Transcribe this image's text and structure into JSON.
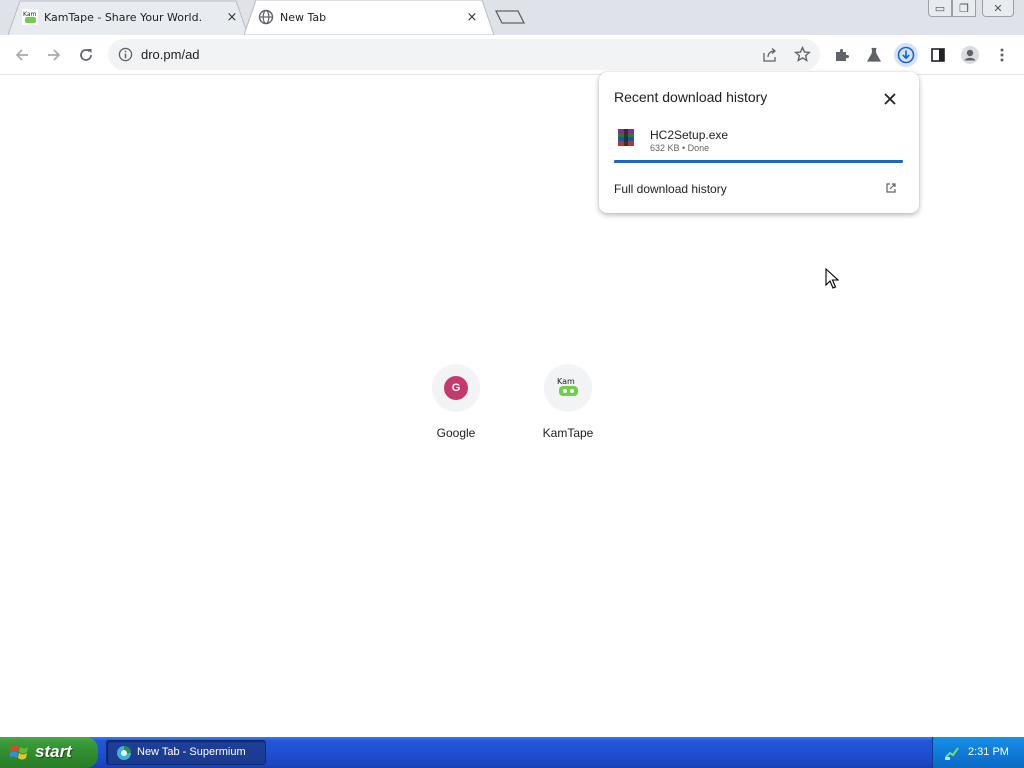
{
  "tabs": [
    {
      "title": "KamTape - Share Your World.",
      "active": false,
      "close": "×"
    },
    {
      "title": "New Tab",
      "active": true,
      "close": "×"
    }
  ],
  "window_controls": {
    "minimize": "▭",
    "restore": "❐",
    "close": "✕"
  },
  "toolbar": {
    "url": "dro.pm/ad",
    "icons": [
      "back-icon",
      "forward-icon",
      "reload-icon",
      "site-info-icon",
      "share-icon",
      "bookmark-star-icon",
      "extensions-icon",
      "labs-icon",
      "download-icon",
      "side-panel-icon",
      "profile-icon",
      "menu-icon"
    ]
  },
  "download_popup": {
    "title": "Recent download history",
    "items": [
      {
        "name": "HC2Setup.exe",
        "status": "632 KB • Done",
        "progress": 1.0
      }
    ],
    "full_history_label": "Full download history"
  },
  "shortcuts": [
    {
      "label": "Google",
      "letter": "G"
    },
    {
      "label": "KamTape"
    }
  ],
  "taskbar": {
    "start_label": "start",
    "task_label": "New Tab - Supermium",
    "clock": "2:31 PM"
  },
  "colors": {
    "accent": "#1a67c8",
    "tabstrip": "#dfe3e9",
    "google_badge": "#c43a6f",
    "taskbar": "#1f4fd2",
    "start_button": "#3b9b39"
  }
}
